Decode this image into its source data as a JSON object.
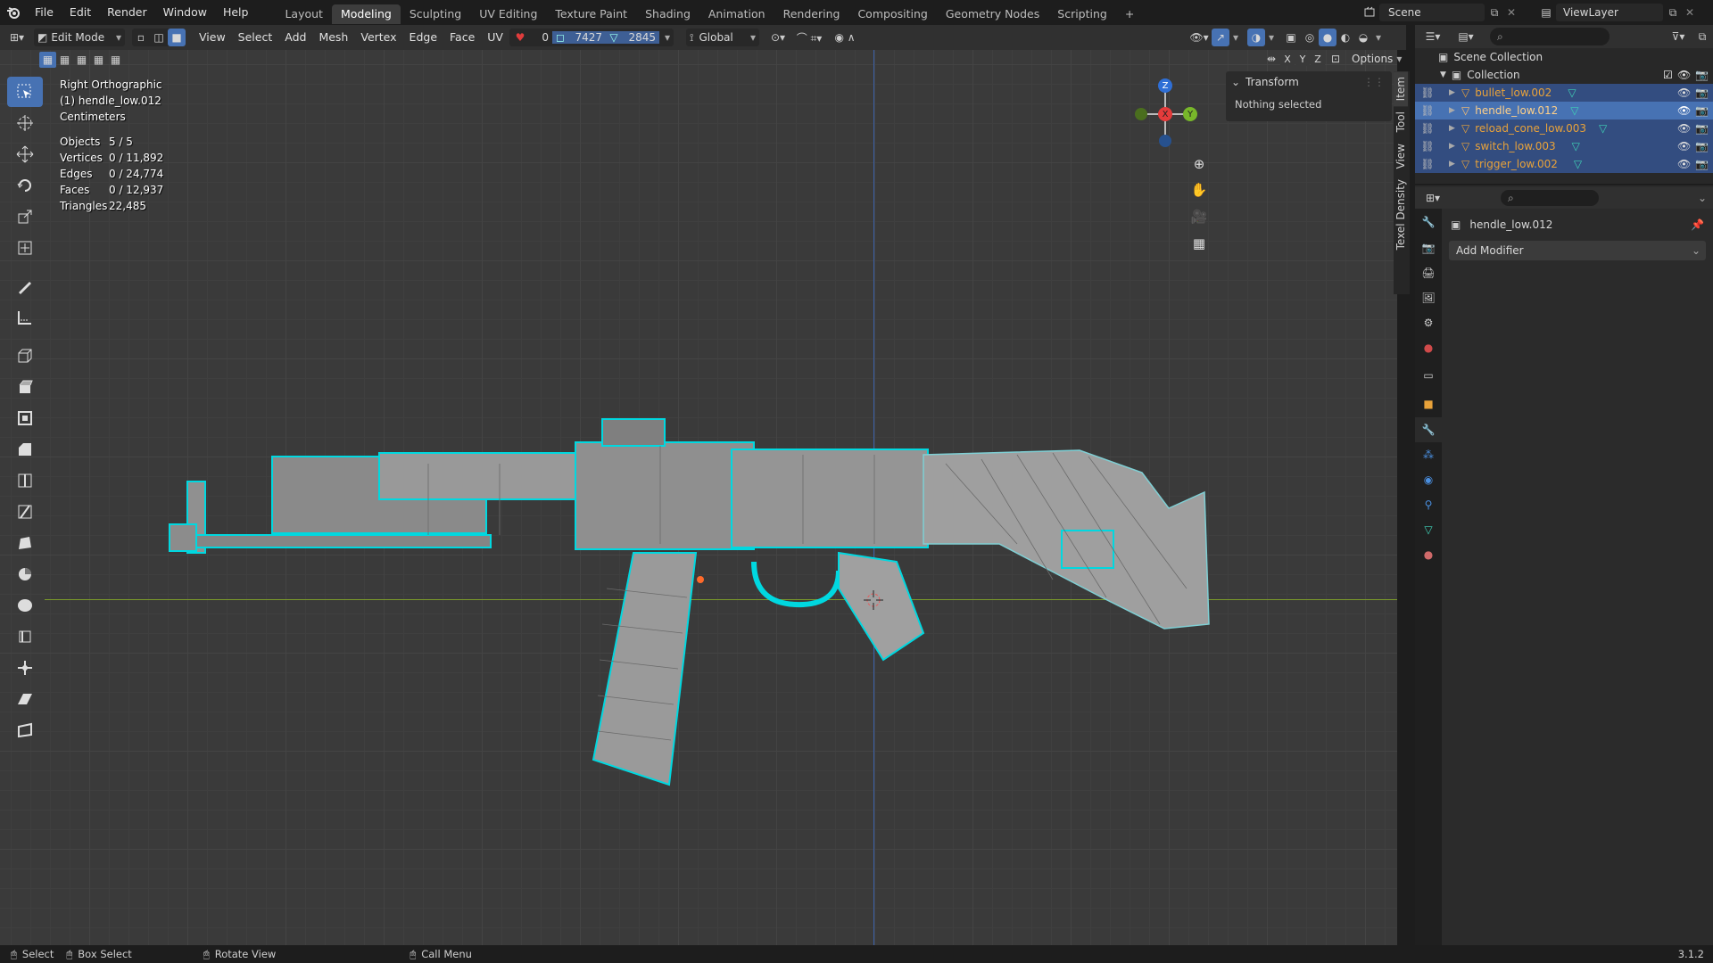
{
  "topbar": {
    "menus": [
      "File",
      "Edit",
      "Render",
      "Window",
      "Help"
    ],
    "workspaces": [
      "Layout",
      "Modeling",
      "Sculpting",
      "UV Editing",
      "Texture Paint",
      "Shading",
      "Animation",
      "Rendering",
      "Compositing",
      "Geometry Nodes",
      "Scripting"
    ],
    "active_workspace": "Modeling",
    "add_tab": "+",
    "scene": "Scene",
    "view_layer": "ViewLayer"
  },
  "header": {
    "mode": "Edit Mode",
    "menus": [
      "View",
      "Select",
      "Add",
      "Mesh",
      "Vertex",
      "Edge",
      "Face",
      "UV"
    ],
    "counts": [
      "0",
      "7427",
      "2845"
    ],
    "orientation": "Global",
    "options": "Options",
    "axes": [
      "X",
      "Y",
      "Z"
    ]
  },
  "overlay": {
    "view": "Right Orthographic",
    "object": "(1) hendle_low.012",
    "units": "Centimeters",
    "stats": [
      {
        "label": "Objects",
        "value": "5 / 5"
      },
      {
        "label": "Vertices",
        "value": "0 / 11,892"
      },
      {
        "label": "Edges",
        "value": "0 / 24,774"
      },
      {
        "label": "Faces",
        "value": "0 / 12,937"
      },
      {
        "label": "Triangles",
        "value": "22,485"
      }
    ]
  },
  "gizmo": {
    "z": "Z",
    "y": "Y",
    "x": "X"
  },
  "npanel": {
    "section": "Transform",
    "empty_text": "Nothing selected",
    "tabs": [
      "Item",
      "Tool",
      "View",
      "Texel Density"
    ]
  },
  "outliner": {
    "root": "Scene Collection",
    "collection": "Collection",
    "objects": [
      {
        "name": "bullet_low.002",
        "selected": true
      },
      {
        "name": "hendle_low.012",
        "selected": true,
        "active": true
      },
      {
        "name": "reload_cone_low.003",
        "selected": true
      },
      {
        "name": "switch_low.003",
        "selected": true
      },
      {
        "name": "trigger_low.002",
        "selected": true
      }
    ]
  },
  "properties": {
    "object_name": "hendle_low.012",
    "add_modifier": "Add Modifier"
  },
  "statusbar": {
    "items": [
      "Select",
      "Box Select",
      "Rotate View",
      "Call Menu"
    ],
    "version": "3.1.2"
  },
  "colors": {
    "accent": "#4772b3",
    "wire": "#00d8e0",
    "object_orange": "#e8a23a",
    "axis_x": "#e53b3b",
    "axis_y": "#78b72a",
    "axis_z": "#2f6fd6"
  }
}
